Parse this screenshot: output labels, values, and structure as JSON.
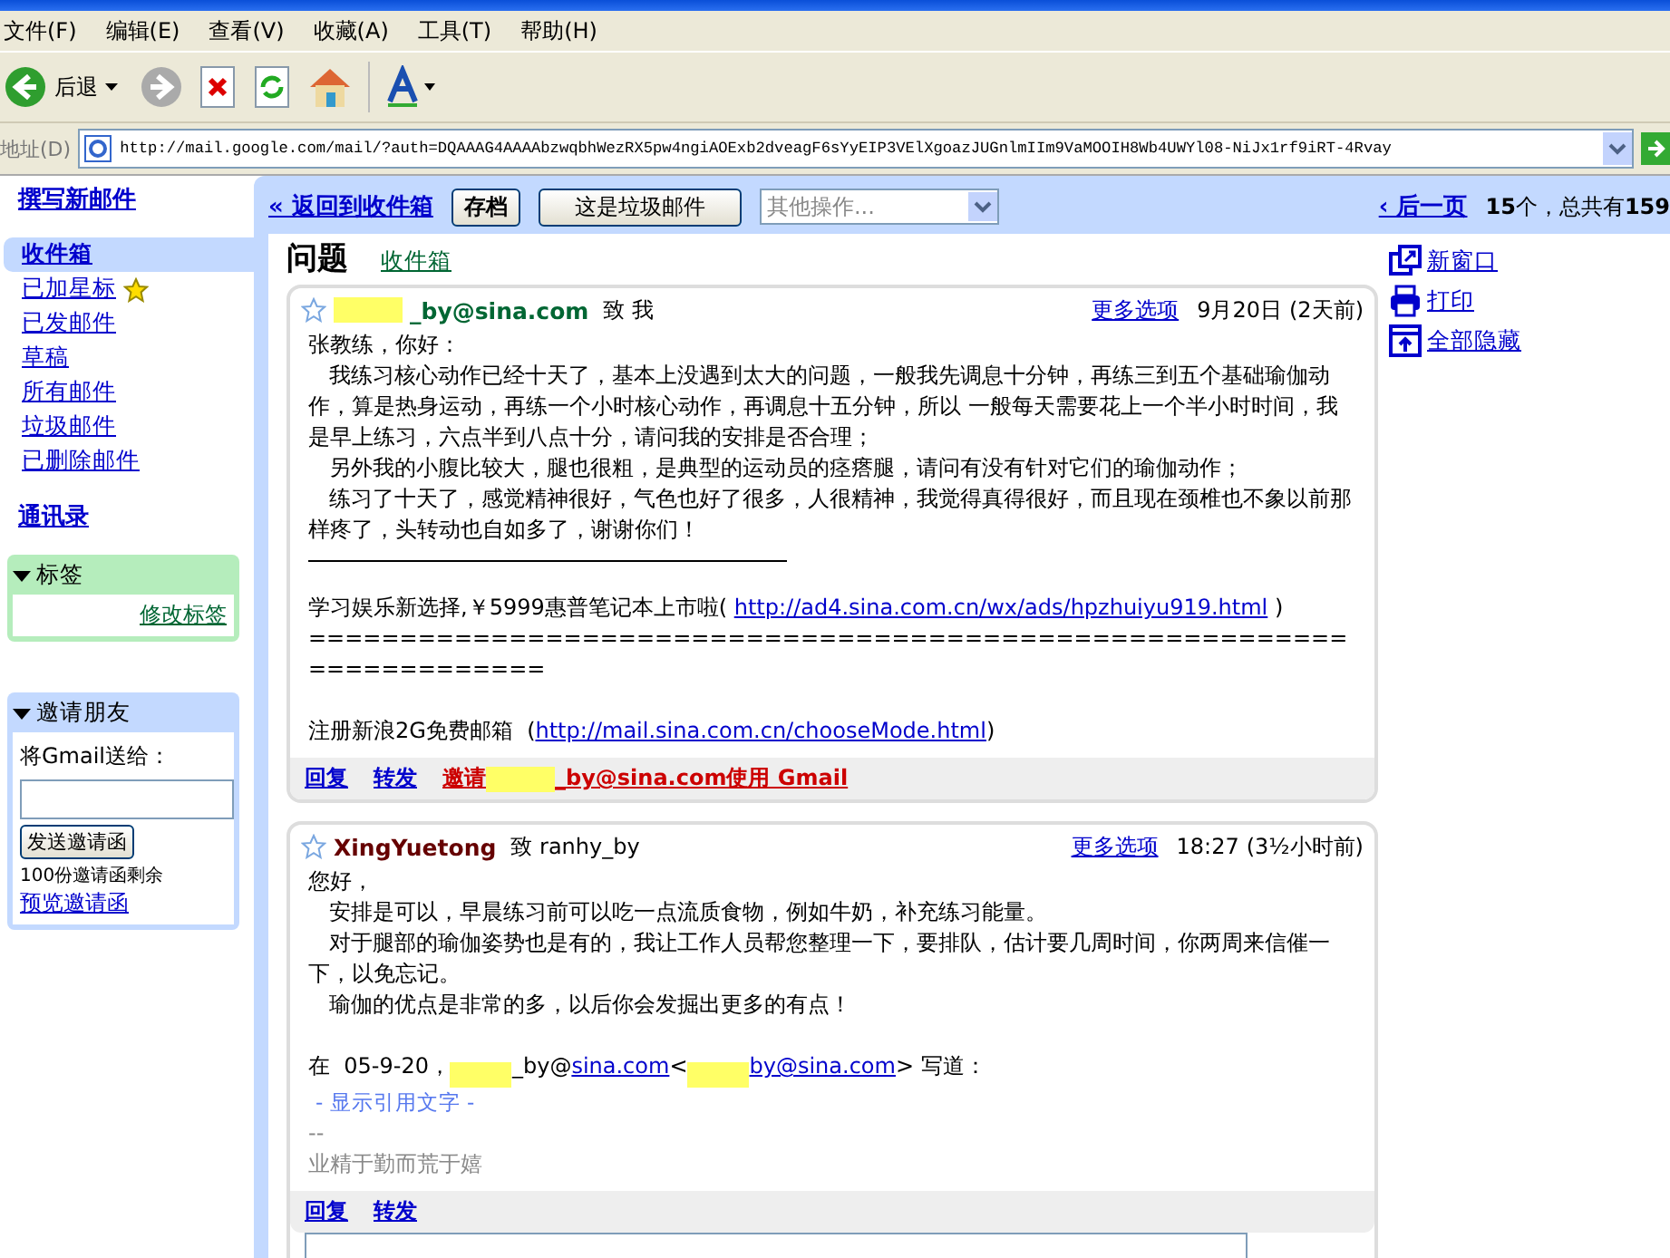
{
  "browser": {
    "menu": [
      "文件(F)",
      "编辑(E)",
      "查看(V)",
      "收藏(A)",
      "工具(T)",
      "帮助(H)"
    ],
    "back_label": "后退",
    "address": {
      "label": "地址(D)",
      "url": "http://mail.google.com/mail/?auth=DQAAAG4AAAAbzwqbhWezRX5pw4ngiAOExb2dveagF6sYyEIP3VElXgoazJUGnlmIIm9VaMOOIH8Wb4UWYl08-NiJx1rf9iRT-4Rvay"
    }
  },
  "sidebar": {
    "compose": "撰写新邮件",
    "folders": [
      {
        "label": "收件箱",
        "selected": true,
        "starred": false
      },
      {
        "label": "已加星标",
        "selected": false,
        "starred": true
      },
      {
        "label": "已发邮件",
        "selected": false,
        "starred": false
      },
      {
        "label": "草稿",
        "selected": false,
        "starred": false
      },
      {
        "label": "所有邮件",
        "selected": false,
        "starred": false
      },
      {
        "label": "垃圾邮件",
        "selected": false,
        "starred": false
      },
      {
        "label": "已删除邮件",
        "selected": false,
        "starred": false
      }
    ],
    "contacts": "通讯录",
    "labels_box": {
      "title": "标签",
      "expanded": true,
      "edit_link": "修改标签"
    },
    "invite_box": {
      "title": "邀请朋友",
      "expanded": true,
      "prompt": "将Gmail送给：",
      "button": "发送邀请函",
      "remaining": "100份邀请函剩余",
      "preview_link": "预览邀请函"
    }
  },
  "toolbar": {
    "back_link": "« 返回到收件箱",
    "buttons": [
      "存档",
      "这是垃圾邮件"
    ],
    "actions_dropdown": {
      "placeholder": "其他操作..."
    },
    "pager_link": "‹ 后一页",
    "count": "**15**个，总共有**159**"
  },
  "thread": {
    "subject": "问题",
    "label": "收件箱",
    "side_actions": [
      {
        "kind": "new-window",
        "label": "新窗口"
      },
      {
        "kind": "print",
        "label": "打印"
      },
      {
        "kind": "collapse",
        "label": "全部隐藏"
      }
    ],
    "messages": [
      {
        "starred": false,
        "sender_redacted": true,
        "sender": "_by@sina.com",
        "color": "#006633",
        "to": "致 我",
        "more_options": "更多选项",
        "date": "9月20日",
        "age": "(2天前)",
        "body": [
          {
            "kind": "text",
            "text": "张教练，你好："
          },
          {
            "kind": "text",
            "text": "   我练习核心动作已经十天了，基本上没遇到太大的问题，一般我先调息十分钟，再练三到五个基础瑜伽动作，算是热身运动，再练一个小时核心动作，再调息十五分钟，所以 一般每天需要花上一个半小时时间，我是早上练习，六点半到八点十分，请问我的安排是否合理；"
          },
          {
            "kind": "text",
            "text": "   另外我的小腹比较大，腿也很粗，是典型的运动员的痉瘩腿，请问有没有针对它们的瑜伽动作；"
          },
          {
            "kind": "text",
            "text": "   练习了十天了，感觉精神很好，气色也好了很多，人很精神，我觉得真得很好，而且现在颈椎也不象以前那样疼了，头转动也自如多了，谢谢你们！"
          },
          {
            "kind": "rule"
          },
          {
            "kind": "link",
            "prefix": "学习娱乐新选择,￥5999惠普笔记本上市啦( ",
            "link": "http://ad4.sina.com.cn/wx/ads/hpzhuiyu919.html",
            "suffix": " )"
          },
          {
            "kind": "text",
            "text": "======================================================================"
          },
          {
            "kind": "link",
            "prefix": "注册新浪2G免费邮箱  (",
            "link": "http://mail.sina.com.cn/chooseMode.html",
            "suffix": ")"
          }
        ],
        "actions": [
          {
            "kind": "reply",
            "label": "回复"
          },
          {
            "kind": "forward",
            "label": "转发"
          },
          {
            "kind": "invite",
            "label": "邀请",
            "label_after": "_by@sina.com使用  Gmail"
          }
        ]
      },
      {
        "starred": false,
        "sender_redacted": false,
        "sender": "XingYuetong",
        "color": "#660000",
        "to": "致  ranhy_by",
        "more_options": "更多选项",
        "date": "18:27",
        "age": "(3½小时前)",
        "body": [
          {
            "kind": "text",
            "text": "您好，"
          },
          {
            "kind": "text",
            "text": "   安排是可以，早晨练习前可以吃一点流质食物，例如牛奶，补充练习能量。"
          },
          {
            "kind": "text",
            "text": "   对于腿部的瑜伽姿势也是有的，我让工作人员帮您整理一下，要排队，估计要几周时间，你两周来信催一下，以免忘记。"
          },
          {
            "kind": "text",
            "text": "   瑜伽的优点是非常的多，以后你会发掘出更多的有点！"
          },
          {
            "kind": "quote",
            "prefix": "在  05-9-20，",
            "mid": "_by@",
            "link1": "sina.com",
            "lt": "<",
            "link2": "by@sina.com",
            "suffix": "> 写道："
          },
          {
            "kind": "toggle",
            "text": "- 显示引用文字 -"
          },
          {
            "kind": "signature",
            "text": "--"
          },
          {
            "kind": "signature",
            "text": "业精于勤而荒于嬉"
          }
        ],
        "actions": [
          {
            "kind": "reply",
            "label": "回复"
          },
          {
            "kind": "forward",
            "label": "转发"
          }
        ]
      }
    ]
  }
}
